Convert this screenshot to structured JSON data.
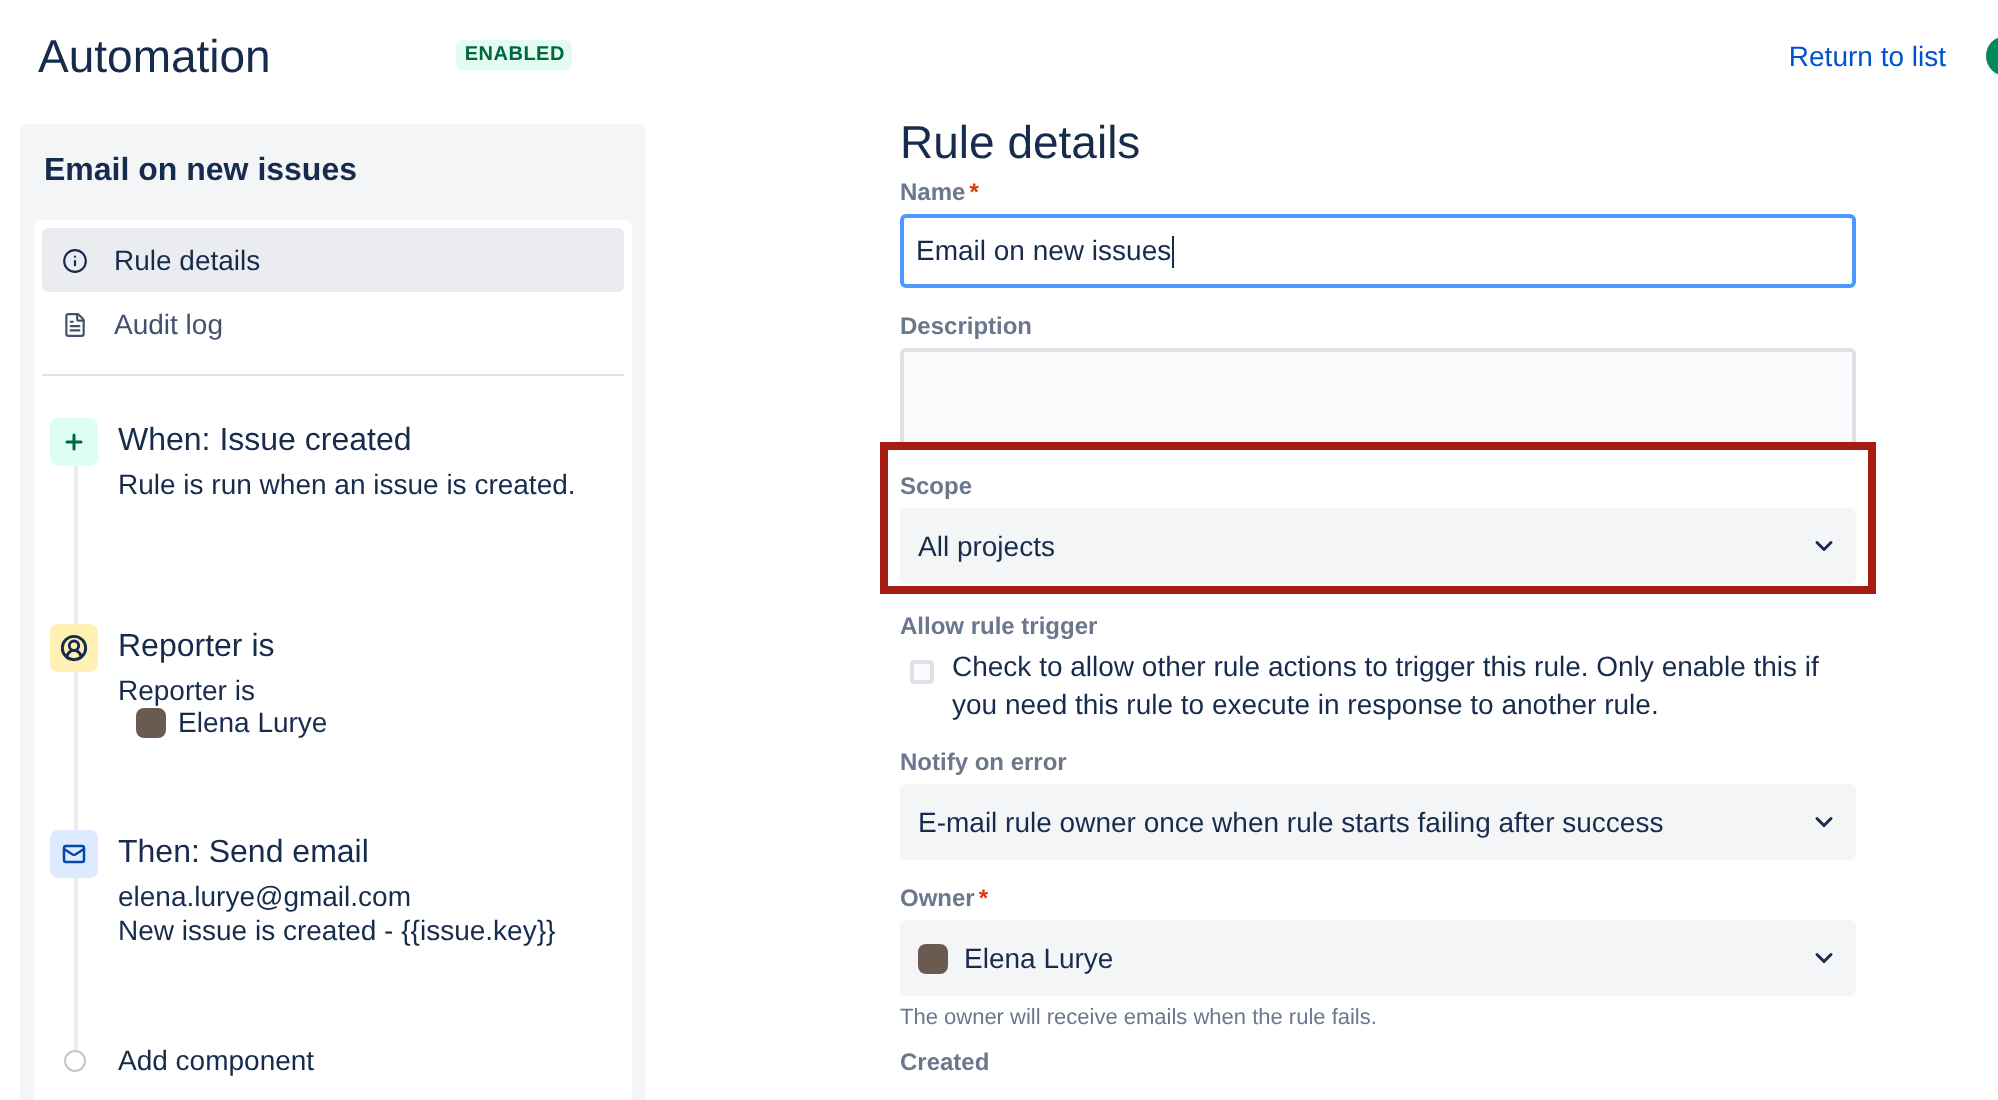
{
  "header": {
    "title": "Automation",
    "status": "ENABLED",
    "return_link": "Return to list"
  },
  "sidebar": {
    "rule_name": "Email on new issues",
    "nav": [
      {
        "label": "Rule details",
        "selected": true
      },
      {
        "label": "Audit log",
        "selected": false
      }
    ],
    "components": [
      {
        "kind": "trigger",
        "title": "When: Issue created",
        "lines": [
          "Rule is run when an issue is created."
        ]
      },
      {
        "kind": "condition",
        "title": "Reporter is",
        "lines": [
          "Reporter is"
        ],
        "user": "Elena Lurye"
      },
      {
        "kind": "action",
        "title": "Then: Send email",
        "lines": [
          "elena.lurye@gmail.com",
          "New issue is created - {{issue.key}}"
        ]
      },
      {
        "kind": "add",
        "title": "Add component"
      }
    ]
  },
  "form": {
    "heading": "Rule details",
    "fields": [
      {
        "kind": "text",
        "label": "Name",
        "required_mark": "*",
        "value": "Email on new issues",
        "focused": true
      },
      {
        "kind": "textarea",
        "label": "Description"
      },
      {
        "kind": "select",
        "label": "Scope",
        "value": "All projects",
        "highlighted": true
      },
      {
        "kind": "checkbox",
        "label": "Allow rule trigger",
        "text": "Check to allow other rule actions to trigger this rule. Only enable this if you need this rule to execute in response to another rule.",
        "checked": false
      },
      {
        "kind": "select",
        "label": "Notify on error",
        "value": "E-mail rule owner once when rule starts failing after success"
      },
      {
        "kind": "user-select",
        "label": "Owner",
        "required_mark": "*",
        "value": "Elena Lurye",
        "help": "The owner will receive emails when the rule fails."
      },
      {
        "kind": "label",
        "label": "Created"
      }
    ]
  }
}
